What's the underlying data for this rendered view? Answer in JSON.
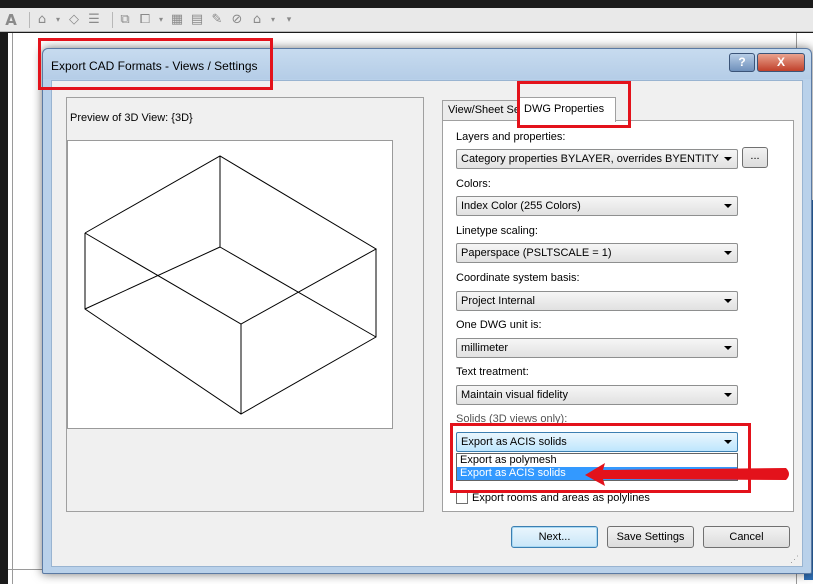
{
  "app": {
    "toolbar_icons": [
      "text-a-icon",
      "home-icon",
      "dropdown-arrow-icon",
      "pin-icon",
      "list-icon",
      "filter-icon",
      "copy-icon",
      "dropdown-arrow-icon",
      "table-icon",
      "edit-table-icon",
      "pencil-icon",
      "no-entry-icon",
      "house-icon",
      "dropdown-arrow-icon",
      "more-icon"
    ]
  },
  "dialog": {
    "title": "Export CAD Formats - Views / Settings",
    "help_label": "?",
    "close_label": "X"
  },
  "preview": {
    "label": "Preview of 3D View: {3D}"
  },
  "tabs": {
    "view_sheet": "View/Sheet Set",
    "dwg_properties": "DWG Properties"
  },
  "fields": {
    "layers": {
      "label": "Layers and properties:",
      "value": "Category properties BYLAYER, overrides BYENTITY",
      "button": "..."
    },
    "colors": {
      "label": "Colors:",
      "value": "Index Color (255 Colors)"
    },
    "linetype": {
      "label": "Linetype scaling:",
      "value": "Paperspace (PSLTSCALE = 1)"
    },
    "coordinate": {
      "label": "Coordinate system basis:",
      "value": "Project Internal"
    },
    "unit": {
      "label": "One DWG unit is:",
      "value": "millimeter"
    },
    "text_treatment": {
      "label": "Text treatment:",
      "value": "Maintain visual fidelity"
    },
    "solids": {
      "label": "Solids (3D views only):",
      "value": "Export as ACIS solids",
      "options": [
        "Export as polymesh",
        "Export as ACIS solids"
      ],
      "highlighted_option": "Export as ACIS solids"
    },
    "rooms_checkbox": {
      "label": "Export rooms and areas as polylines",
      "checked": false
    }
  },
  "buttons": {
    "next": "Next...",
    "save": "Save Settings",
    "cancel": "Cancel"
  },
  "colors": {
    "annotation": "#e3121b",
    "selection": "#3399ff",
    "dialog_frame": "#b9d1ea"
  }
}
